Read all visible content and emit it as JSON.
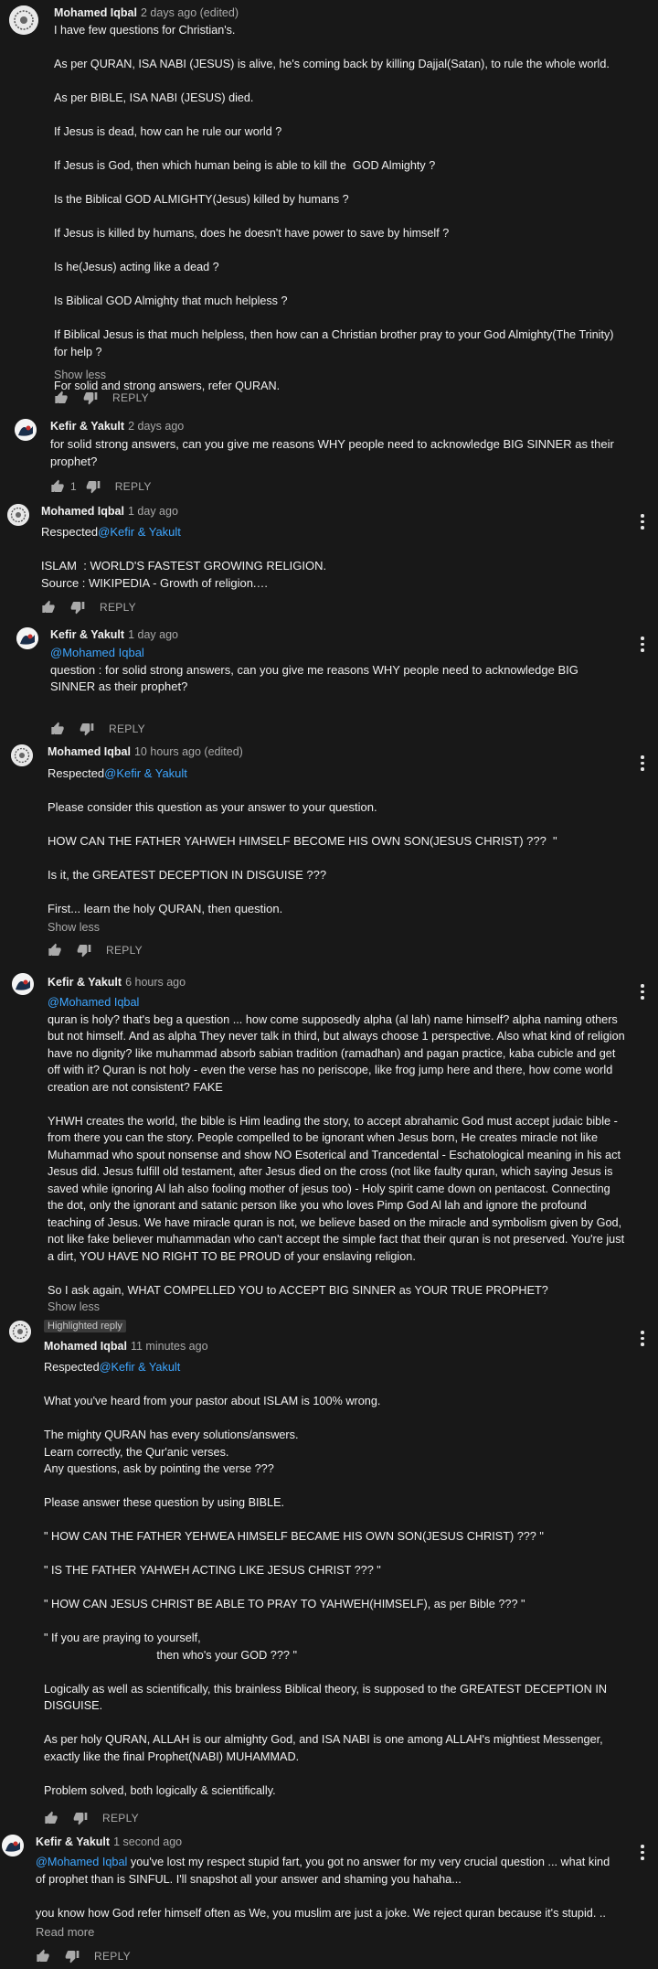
{
  "colors": {
    "background": "#181818",
    "mention": "#3ea6ff",
    "muted": "#aaaaaa"
  },
  "labels": {
    "reply": "REPLY",
    "show_less": "Show less",
    "read_more": "Read more",
    "highlighted": "Highlighted reply"
  },
  "comments": [
    {
      "author": "Mohamed Iqbal",
      "time": "2 days ago (edited)",
      "paragraphs": [
        "I have few questions for Christian's.",
        "As per QURAN, ISA NABI (JESUS) is alive, he's coming back by killing Dajjal(Satan), to rule the whole world.",
        "As per BIBLE, ISA NABI (JESUS) died.",
        "If Jesus is dead, how can he rule our world ?",
        "If Jesus is God, then which human being is able to kill the  GOD Almighty ?",
        "Is the Biblical GOD ALMIGHTY(Jesus) killed by humans ?",
        "If Jesus is killed by humans, does he doesn't have power to save by himself ?",
        "Is he(Jesus) acting like a dead ?",
        "Is Biblical GOD Almighty that much helpless ?",
        "If Biblical Jesus is that much helpless, then how can a Christian brother pray to your God Almighty(The Trinity) for help ?",
        "For solid and strong answers, refer QURAN."
      ]
    },
    {
      "author": "Kefir & Yakult",
      "time": "2 days ago",
      "likes": "1",
      "paragraphs": [
        "for solid strong answers, can you give me reasons WHY people need to acknowledge BIG SINNER as their prophet?"
      ]
    },
    {
      "author": "Mohamed Iqbal",
      "time": "1 day ago",
      "prefix": "Respected",
      "mention": "@Kefir & Yakult",
      "paragraphs": [
        "ISLAM  : WORLD'S FASTEST GROWING RELIGION.\nSource : WIKIPEDIA - Growth of religion.…"
      ]
    },
    {
      "author": "Kefir & Yakult",
      "time": "1 day ago",
      "mention": "@Mohamed Iqbal",
      "paragraphs": [
        "question : for solid strong answers, can you give me reasons WHY people need to acknowledge BIG SINNER as their prophet?"
      ]
    },
    {
      "author": "Mohamed Iqbal",
      "time": "10 hours ago (edited)",
      "prefix": "Respected",
      "mention": "@Kefir & Yakult",
      "paragraphs": [
        "Please consider this question as your answer to your question.",
        "HOW CAN THE FATHER YAHWEH HIMSELF BECOME HIS OWN SON(JESUS CHRIST) ???  \"",
        "Is it, the GREATEST DECEPTION IN DISGUISE ???",
        "First... learn the holy QURAN, then question."
      ]
    },
    {
      "author": "Kefir & Yakult",
      "time": "6 hours ago",
      "mention": "@Mohamed Iqbal",
      "paragraphs": [
        "quran is holy? that's beg a question ... how come supposedly alpha (al lah) name himself? alpha naming others but not himself. And as alpha They never talk in third, but always choose 1 perspective. Also what kind of religion have no dignity? like muhammad absorb sabian tradition (ramadhan) and pagan practice, kaba cubicle and get off with it? Quran is not holy - even the verse has no periscope, like frog jump here and there, how come world creation are not consistent? FAKE",
        "YHWH creates the world, the bible is Him leading the story, to accept abrahamic God must accept judaic bible - from there you can the story. People compelled to be ignorant when Jesus born, He creates miracle not like Muhammad who spout nonsense and show NO Esoterical and Trancedental - Eschatological meaning in his act Jesus did. Jesus fulfill old testament, after Jesus died on the cross (not like faulty quran, which saying Jesus is saved while ignoring Al lah also fooling mother of jesus too) - Holy spirit came down on pentacost. Connecting the dot, only the ignorant and satanic person like you who loves Pimp God Al lah and ignore the profound teaching of Jesus. We have miracle quran is not, we believe based on the miracle and symbolism given by God, not like fake believer muhammadan who can't accept the simple fact that their quran is not preserved. You're just a dirt, YOU HAVE NO RIGHT TO BE PROUD of your enslaving religion.",
        "So I ask again, WHAT COMPELLED YOU to ACCEPT BIG SINNER as YOUR TRUE PROPHET?"
      ]
    },
    {
      "author": "Mohamed Iqbal",
      "time": "11 minutes ago",
      "prefix": "Respected",
      "mention": "@Kefir & Yakult",
      "paragraphs": [
        "What you've heard from your pastor about ISLAM is 100% wrong.",
        "The mighty QURAN has every solutions/answers.\nLearn correctly, the Qur'anic verses.\nAny questions, ask by pointing the verse ???",
        "Please answer these question by using BIBLE.",
        "\" HOW CAN THE FATHER YEHWEA HIMSELF BECAME HIS OWN SON(JESUS CHRIST) ??? \"",
        "\" IS THE FATHER YAHWEH ACTING LIKE JESUS CHRIST ??? \"",
        "\" HOW CAN JESUS CHRIST BE ABLE TO PRAY TO YAHWEH(HIMSELF), as per Bible ??? \"",
        "\" If you are praying to yourself,\n                                   then who's your GOD ??? \"",
        "Logically as well as scientifically, this brainless Biblical theory, is supposed to the GREATEST DECEPTION IN DISGUISE.",
        "As per holy QURAN, ALLAH is our almighty God, and ISA NABI is one among ALLAH's mightiest Messenger, exactly like the final Prophet(NABI) MUHAMMAD.",
        "Problem solved, both logically & scientifically."
      ]
    },
    {
      "author": "Kefir & Yakult",
      "time": "1 second ago",
      "mention": "@Mohamed Iqbal",
      "inline_text": " you've lost my respect stupid fart, you got no answer for my very crucial question ... what kind of prophet than is SINFUL. I'll snapshot all your answer and shaming you hahaha...",
      "paragraphs": [
        "you know how God refer himself often as We, you muslim are just a joke. We reject quran because it's stupid. .."
      ]
    }
  ]
}
